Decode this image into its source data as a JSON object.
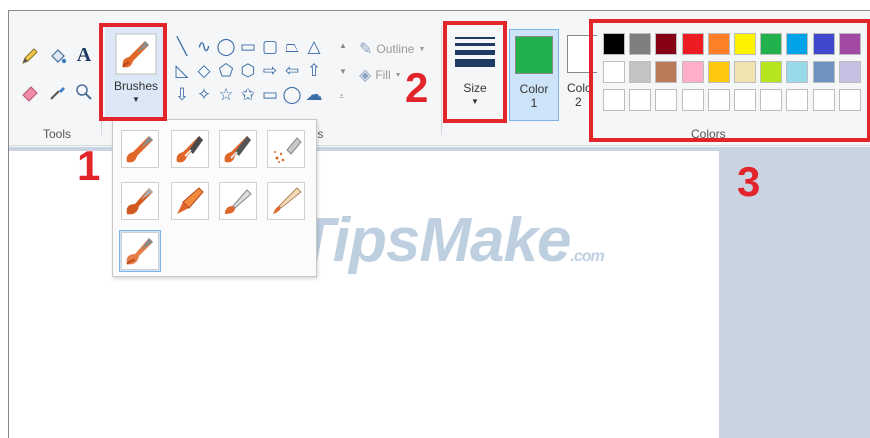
{
  "ribbon": {
    "tools_label": "Tools",
    "brushes_label": "Brushes",
    "shapes_label_partial": "pes",
    "outline_label": "Outline",
    "fill_label": "Fill",
    "size_label": "Size",
    "color1_label": "Color",
    "color1_num": "1",
    "color2_label": "Colo",
    "color2_num": "2",
    "colors_label": "Colors",
    "color1_value": "#22b14c"
  },
  "palette": {
    "row1": [
      "#000000",
      "#7f7f7f",
      "#880015",
      "#ed1c24",
      "#ff7f27",
      "#fff200",
      "#22b14c",
      "#00a2e8",
      "#3f48cc",
      "#a349a4"
    ],
    "row2": [
      "#ffffff",
      "#c3c3c3",
      "#b97a57",
      "#ffaec9",
      "#ffc90e",
      "#efe4b0",
      "#b5e61d",
      "#99d9ea",
      "#7092be",
      "#c8bfe7"
    ],
    "row3": [
      "#ffffff",
      "#ffffff",
      "#ffffff",
      "#ffffff",
      "#ffffff",
      "#ffffff",
      "#ffffff",
      "#ffffff",
      "#ffffff",
      "#ffffff"
    ]
  },
  "annotations": {
    "num1": "1",
    "num2": "2",
    "num3": "3",
    "accent": "#e2242b"
  },
  "watermark": {
    "main": "TipsMake",
    "sub": ".com"
  },
  "shapes": [
    "╲",
    "∿",
    "◯",
    "▭",
    "▢",
    "⏢",
    "△",
    "◺",
    "◇",
    "⬠",
    "⬡",
    "⇨",
    "⇦",
    "⇧",
    "⇩",
    "✧",
    "☆",
    "✩",
    "▭",
    "◯",
    "☁"
  ],
  "brush_options": [
    "brush",
    "calligraphy-brush-1",
    "calligraphy-brush-2",
    "airbrush",
    "oil-brush",
    "crayon",
    "marker",
    "natural-pencil",
    "watercolor-brush"
  ]
}
